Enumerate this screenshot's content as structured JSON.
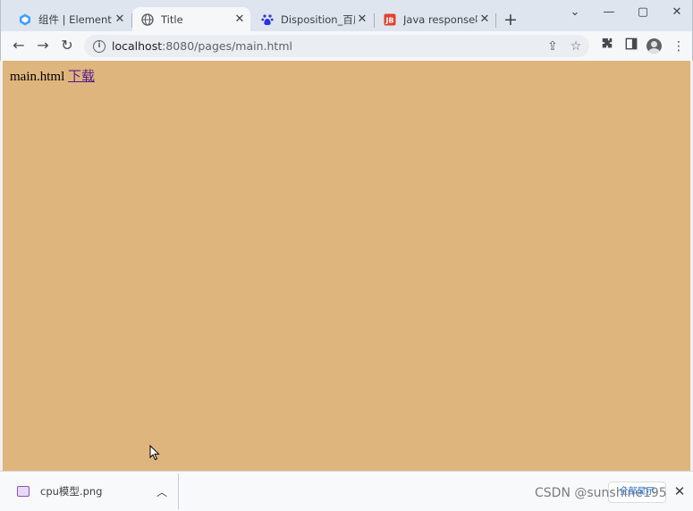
{
  "tabs": [
    {
      "title": "组件 | Element",
      "icon": "element-icon",
      "active": false
    },
    {
      "title": "Title",
      "icon": "globe-icon",
      "active": true
    },
    {
      "title": "Disposition_百度",
      "icon": "baidu-icon",
      "active": false
    },
    {
      "title": "Java response响",
      "icon": "jb-icon",
      "active": false
    }
  ],
  "toolbar": {
    "url_host": "localhost",
    "url_path": ":8080/pages/main.html"
  },
  "page": {
    "text": "main.html",
    "link_text": "下载",
    "background": "#deb57d"
  },
  "downloads": {
    "filename": "cpu模型.png",
    "show_all": "全部显示",
    "watermark": "CSDN @sunshine195"
  }
}
